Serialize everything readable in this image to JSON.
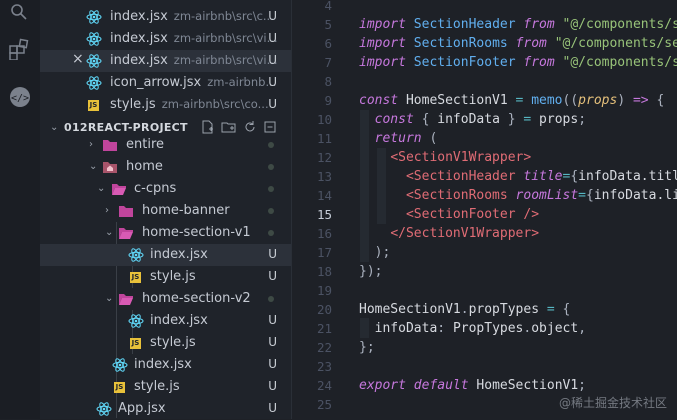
{
  "open_editors": [
    {
      "name": "index.jsx",
      "path": "zm-airbnb\\src\\c...",
      "badge": "U",
      "icon": "react-icon"
    },
    {
      "name": "index.jsx",
      "path": "zm-airbnb\\src\\vi...",
      "badge": "U",
      "icon": "react-icon"
    },
    {
      "name": "index.jsx",
      "path": "zm-airbnb\\src\\vi...",
      "badge": "U",
      "icon": "react-icon",
      "close": "×"
    },
    {
      "name": "icon_arrow.jsx",
      "path": "zm-airbnb...",
      "badge": "U",
      "icon": "react-icon"
    },
    {
      "name": "style.js",
      "path": "zm-airbnb\\src\\co...",
      "badge": "U",
      "icon": "js-icon"
    }
  ],
  "project": {
    "title": "012REACT-PROJECT"
  },
  "tree": [
    {
      "name": "entire",
      "type": "folder",
      "badge": ""
    },
    {
      "name": "home",
      "type": "folder-home",
      "badge": ""
    },
    {
      "name": "c-cpns",
      "type": "folder",
      "badge": ""
    },
    {
      "name": "home-banner",
      "type": "folder",
      "badge": ""
    },
    {
      "name": "home-section-v1",
      "type": "folder",
      "badge": ""
    },
    {
      "name": "index.jsx",
      "type": "react",
      "badge": "U"
    },
    {
      "name": "style.js",
      "type": "js",
      "badge": "U"
    },
    {
      "name": "home-section-v2",
      "type": "folder",
      "badge": ""
    },
    {
      "name": "index.jsx",
      "type": "react",
      "badge": "U"
    },
    {
      "name": "style.js",
      "type": "js",
      "badge": "U"
    },
    {
      "name": "index.jsx",
      "type": "react",
      "badge": "U"
    },
    {
      "name": "style.js",
      "type": "js",
      "badge": "U"
    },
    {
      "name": "App.jsx",
      "type": "react",
      "badge": "U"
    }
  ],
  "editor": {
    "line_numbers": [
      "4",
      "5",
      "6",
      "7",
      "8",
      "9",
      "10",
      "11",
      "12",
      "13",
      "14",
      "15",
      "16",
      "17",
      "18",
      "19",
      "20",
      "21",
      "22",
      "23",
      "24",
      "25"
    ],
    "current_line": "15",
    "lines": [
      "",
      "import SectionHeader from \"@/components/se",
      "import SectionRooms from \"@/components/se",
      "import SectionFooter from \"@/components/se",
      "",
      "const HomeSectionV1 = memo((props) => {",
      "  const { infoData } = props;",
      "  return (",
      "    <SectionV1Wrapper>",
      "      <SectionHeader title={infoData.title",
      "      <SectionRooms roomList={infoData.lis",
      "      <SectionFooter />",
      "    </SectionV1Wrapper>",
      "  );",
      "});",
      "",
      "HomeSectionV1.propTypes = {",
      "  infoData: PropTypes.object,",
      "};",
      "",
      "export default HomeSectionV1;",
      ""
    ]
  },
  "watermark": "@稀土掘金技术社区",
  "colors": {
    "react": "#61dafb",
    "folder": "#c0459c",
    "js": "#e8c13a"
  }
}
